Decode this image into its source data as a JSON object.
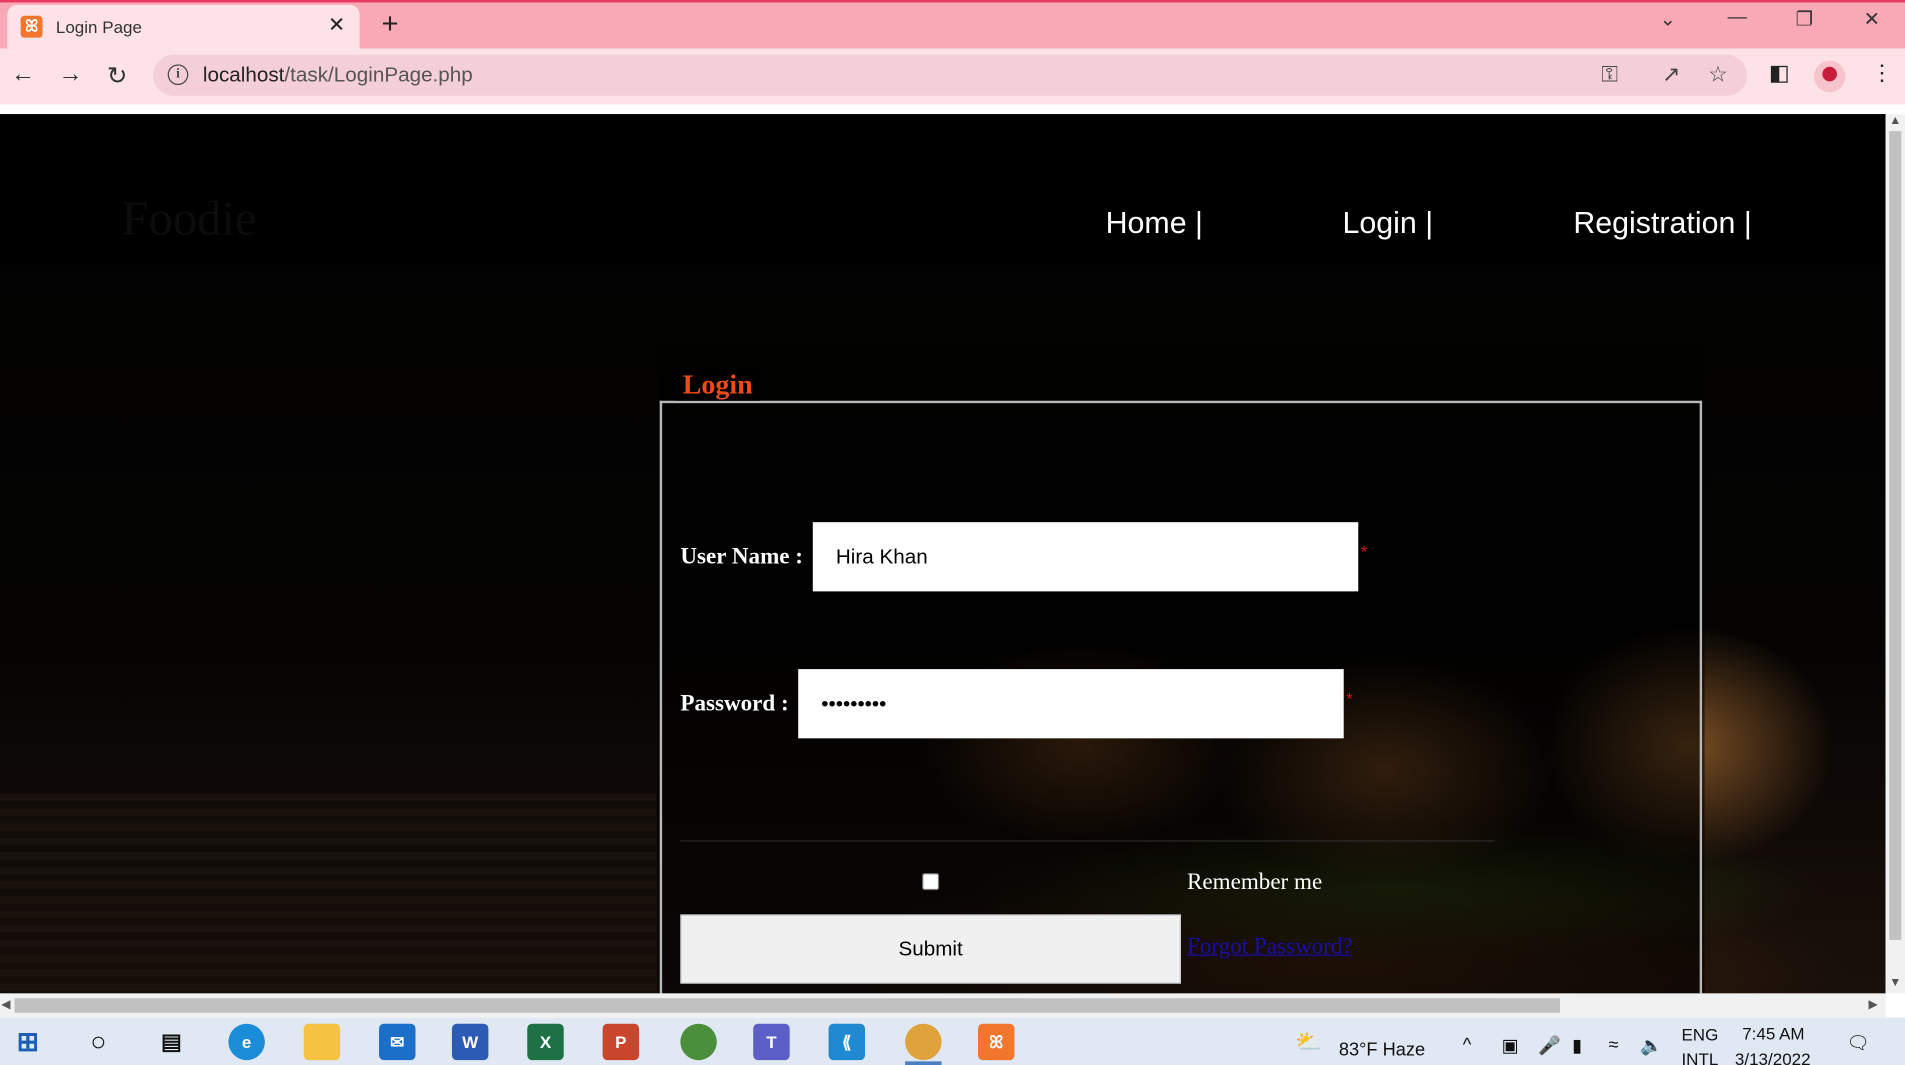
{
  "browser": {
    "tab_title": "Login Page",
    "tab_close": "✕",
    "new_tab": "+",
    "url_host": "localhost",
    "url_path": "/task/LoginPage.php",
    "window_controls": {
      "tab_search": "⌄",
      "minimize": "—",
      "restore": "❐",
      "close": "✕"
    }
  },
  "page": {
    "brand": "Foodie",
    "nav": [
      "Home |",
      "Login |",
      "Registration |"
    ],
    "form": {
      "legend": "Login",
      "username_label": "User Name :",
      "username_value": "Hira Khan",
      "password_label": "Password :",
      "password_value": "123456789",
      "required_mark": "*",
      "remember_label": "Remember me",
      "submit_label": "Submit",
      "forgot_label": "Forgot Password?"
    }
  },
  "taskbar": {
    "weather": "83°F  Haze",
    "lang_1": "ENG",
    "lang_2": "INTL",
    "time": "7:45 AM",
    "date": "3/13/2022"
  },
  "colors": {
    "legend": "#f04a14",
    "required": "#e01010",
    "link": "#1a0dab",
    "titlebar": "#f9a8b6"
  }
}
